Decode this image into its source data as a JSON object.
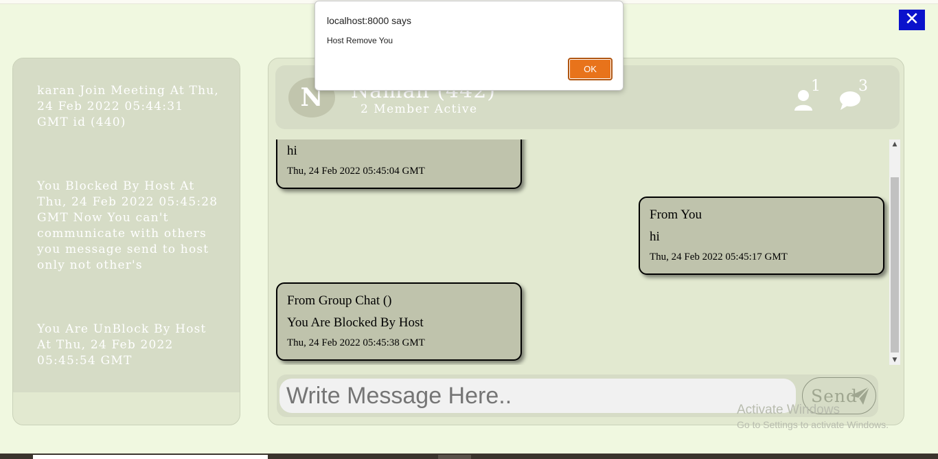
{
  "dialog": {
    "title": "localhost:8000 says",
    "message": "Host Remove You",
    "ok_label": "OK"
  },
  "close_icon_label": "✕",
  "notifications": [
    "karan Join Meeting At Thu, 24 Feb 2022 05:44:31 GMT id (440)",
    "You Blocked By Host At Thu, 24 Feb 2022 05:45:28 GMT Now You can't communicate with others you message send to host only not other's",
    "You Are UnBlock By Host At Thu, 24 Feb 2022 05:45:54 GMT"
  ],
  "header": {
    "avatar_letter": "N",
    "title": "Naman (442)",
    "subtitle": "2 Member Active",
    "members_count": "1",
    "messages_count": "3"
  },
  "messages": [
    {
      "from": "",
      "text": "hi",
      "time": "Thu, 24 Feb 2022 05:45:04 GMT"
    },
    {
      "from": "From You",
      "text": "hi",
      "time": "Thu, 24 Feb 2022 05:45:17 GMT"
    },
    {
      "from": "From Group Chat ()",
      "text": "You Are Blocked By Host",
      "time": "Thu, 24 Feb 2022 05:45:38 GMT"
    }
  ],
  "composer": {
    "placeholder": "Write Message Here..",
    "send_label": "Send"
  },
  "watermark": {
    "line1": "Activate Windows",
    "line2": "Go to Settings to activate Windows."
  },
  "colors": {
    "background": "#f0f8e0",
    "panel": "#e2e9d0",
    "bubble": "#bfc3ac",
    "ok_button": "#e8731b",
    "close_button": "#0a12cc"
  }
}
